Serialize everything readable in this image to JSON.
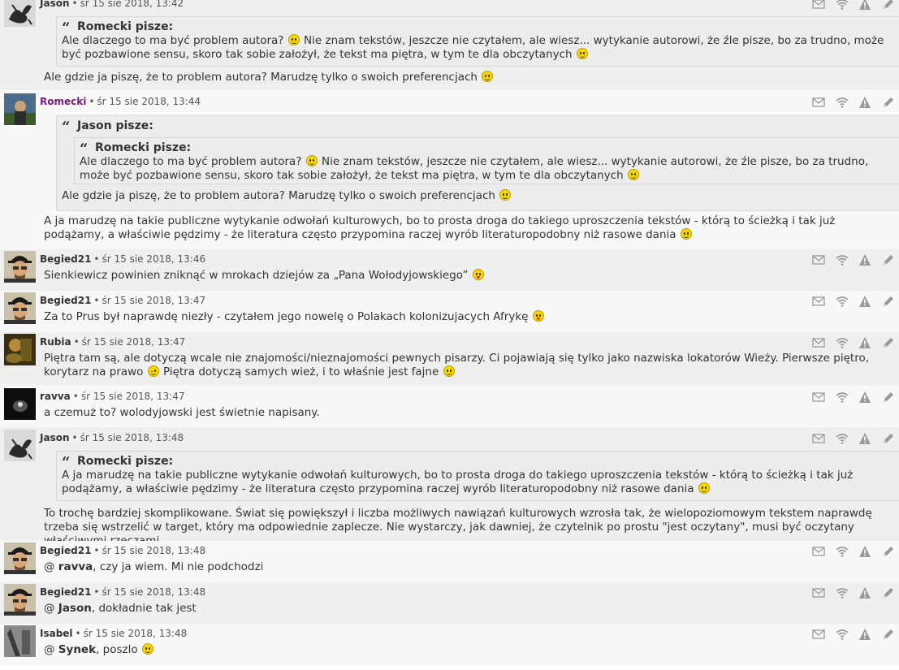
{
  "posts": [
    {
      "author": "Jason",
      "date": "śr 15 sie 2018, 13:42",
      "quote": {
        "head": "Romecki pisze:",
        "parts": [
          "Ale dlaczego to ma być problem autora? ",
          ":)",
          " Nie znam tekstów, jeszcze nie czytałem, ale wiesz... wytykanie autorowi, że źle pisze, bo za trudno, może być pozbawione sensu, skoro tak sobie założył, że tekst ma piętra, w tym te dla obczytanych ",
          ":)"
        ]
      },
      "text": [
        "Ale gdzie ja piszę, że to problem autora? Marudzę tylko o swoich preferencjach ",
        ":)"
      ]
    },
    {
      "author": "Romecki",
      "date": "śr 15 sie 2018, 13:44",
      "outer_quote_head": "Jason pisze:",
      "inner_quote": {
        "head": "Romecki pisze:",
        "parts": [
          "Ale dlaczego to ma być problem autora? ",
          ":)",
          " Nie znam tekstów, jeszcze nie czytałem, ale wiesz... wytykanie autorowi, że źle pisze, bo za trudno, może być pozbawione sensu, skoro tak sobie założył, że tekst ma piętra, w tym te dla obczytanych ",
          ":)"
        ]
      },
      "outer_quote_text": [
        "Ale gdzie ja piszę, że to problem autora? Marudzę tylko o swoich preferencjach ",
        ":)"
      ],
      "text": [
        "A ja marudzę na takie publiczne wytykanie odwołań kulturowych, bo to prosta droga do takiego uproszczenia tekstów - którą to ścieżką i tak już podążamy, a właściwie pędzimy - że literatura często przypomina raczej wyrób literaturopodobny niż rasowe dania ",
        ":)"
      ]
    },
    {
      "author": "Begied21",
      "date": "śr 15 sie 2018, 13:46",
      "text": [
        "Sienkiewicz powinien zniknąć w mrokach dziejów za „Pana Wołodyjowskiego” ",
        ":P"
      ]
    },
    {
      "author": "Begied21",
      "date": "śr 15 sie 2018, 13:47",
      "text": [
        "Za to Prus był naprawdę niezły - czytałem jego nowelę o Polakach kolonizujacych Afrykę ",
        ":P"
      ]
    },
    {
      "author": "Rubia",
      "date": "śr 15 sie 2018, 13:47",
      "text": [
        "Piętra tam są, ale dotyczą wcale nie znajomości/nieznajomości pewnych pisarzy. Ci pojawiają się tylko jako nazwiska lokatorów Wieży. Pierwsze piętro, korytarz na prawo ",
        ";)",
        " Piętra dotyczą samych wież, i to właśnie jest fajne ",
        ":D"
      ]
    },
    {
      "author": "ravva",
      "date": "śr 15 sie 2018, 13:47",
      "text": [
        "a czemuż to? wolodyjowski jest świetnie napisany."
      ]
    },
    {
      "author": "Jason",
      "date": "śr 15 sie 2018, 13:48",
      "quote": {
        "head": "Romecki pisze:",
        "parts": [
          "A ja marudzę na takie publiczne wytykanie odwołań kulturowych, bo to prosta droga do takiego uproszczenia tekstów - którą to ścieżką i tak już podążamy, a właściwie pędzimy - że literatura często przypomina raczej wyrób literaturopodobny niż rasowe dania ",
          ":)"
        ]
      },
      "text": [
        "To trochę bardziej skomplikowane. Świat się powiększył i liczba możliwych nawiązań kulturowych wzrosła tak, że wielopoziomowym tekstem naprawdę trzeba się wstrzelić w target, który ma odpowiednie zaplecze. Nie wystarczy, jak dawniej, że czytelnik po prostu \"jest oczytany\", musi być oczytany właściwymi rzeczami."
      ]
    },
    {
      "author": "Begied21",
      "date": "śr 15 sie 2018, 13:48",
      "mention": "ravva",
      "text": [
        ", czy ja wiem. Mi nie podchodzi"
      ]
    },
    {
      "author": "Begied21",
      "date": "śr 15 sie 2018, 13:48",
      "mention": "Jason",
      "text": [
        ", dokładnie tak jest"
      ]
    },
    {
      "author": "Isabel",
      "date": "śr 15 sie 2018, 13:48",
      "mention": "Synek",
      "text": [
        ", poszlo ",
        ":)"
      ]
    }
  ],
  "ui": {
    "separator": "•",
    "at_sign": "@ ",
    "action_icons": [
      "envelope-icon",
      "wifi-icon",
      "warning-icon",
      "pencil-icon",
      "trash-icon"
    ],
    "colors": {
      "author": "#333333",
      "author_highlight": "#7a1a7a",
      "row_grey": "#efefef",
      "row_light": "#f8f8f8",
      "quote_bg": "#ececec"
    }
  }
}
